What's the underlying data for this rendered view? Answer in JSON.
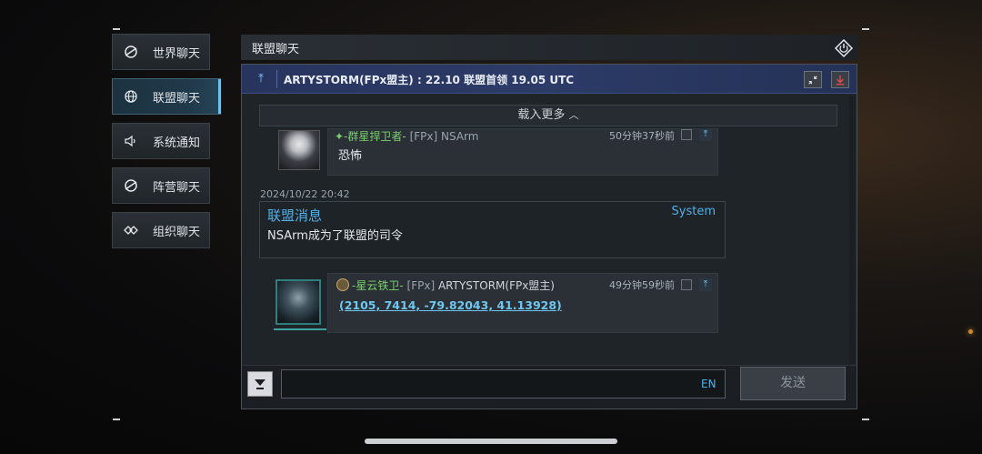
{
  "sidebar": {
    "items": [
      {
        "label": "世界聊天",
        "icon": "world-chat-icon",
        "active": false
      },
      {
        "label": "联盟聊天",
        "icon": "globe-icon",
        "active": true
      },
      {
        "label": "系统通知",
        "icon": "speaker-icon",
        "active": false
      },
      {
        "label": "阵营聊天",
        "icon": "planet-icon",
        "active": false
      },
      {
        "label": "组织聊天",
        "icon": "diamond-link-icon",
        "active": false
      }
    ]
  },
  "header": {
    "title": "联盟聊天"
  },
  "pinned": {
    "text": "ARTYSTORM(FPx盟主) : 22.10 联盟首领 19.05 UTC"
  },
  "load_more": {
    "label": "载入更多"
  },
  "messages": [
    {
      "rank": "群星捍卫者",
      "tag": "[FPx]",
      "name": "NSArm",
      "time": "50分钟37秒前",
      "text": "恐怖"
    },
    {
      "rank": "星云铁卫",
      "tag": "[FPx]",
      "name": "ARTYSTORM(FPx盟主)",
      "time": "49分钟59秒前",
      "text": "(2105, 7414, -79.82043, 41.13928)"
    }
  ],
  "system": {
    "date": "2024/10/22 20:42",
    "title": "联盟消息",
    "tag": "System",
    "body": "NSArm成为了联盟的司令"
  },
  "input": {
    "value": "",
    "lang": "EN",
    "send_label": "发送"
  },
  "colors": {
    "accent": "#4fb0e8",
    "pinned_bg": "#2c3b67",
    "rank_green": "#79d06b"
  }
}
